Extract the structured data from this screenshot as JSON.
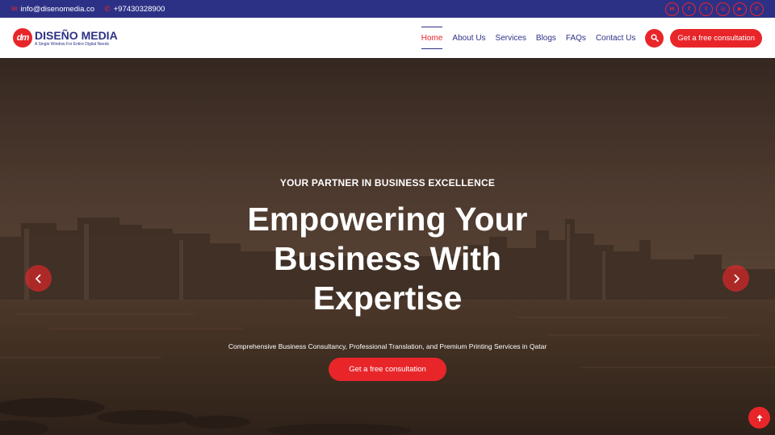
{
  "topbar": {
    "email": "info@disenomedia.co",
    "phone": "+97430328900",
    "socials": [
      {
        "icon": "linkedin-icon",
        "glyph": "in"
      },
      {
        "icon": "facebook-icon",
        "glyph": "f"
      },
      {
        "icon": "twitter-icon",
        "glyph": "t"
      },
      {
        "icon": "instagram-icon",
        "glyph": "◎"
      },
      {
        "icon": "youtube-icon",
        "glyph": "▶"
      },
      {
        "icon": "whatsapp-icon",
        "glyph": "✆"
      }
    ]
  },
  "header": {
    "logo_mark": "dm",
    "logo_name": "DISEÑO MEDIA",
    "logo_tagline": "A Single Window For Entire Digital Needs",
    "nav": [
      "Home",
      "About Us",
      "Services",
      "Blogs",
      "FAQs",
      "Contact Us"
    ],
    "active_nav": "Home",
    "cta": "Get a free consultation"
  },
  "hero": {
    "kicker": "YOUR PARTNER IN BUSINESS EXCELLENCE",
    "title": "Empowering Your Business With Expertise",
    "subtitle": "Comprehensive Business Consultancy, Professional Translation, and Premium Printing Services in Qatar",
    "cta": "Get a free consultation"
  },
  "colors": {
    "brand_blue": "#2d3186",
    "accent_red": "#e8262a"
  }
}
